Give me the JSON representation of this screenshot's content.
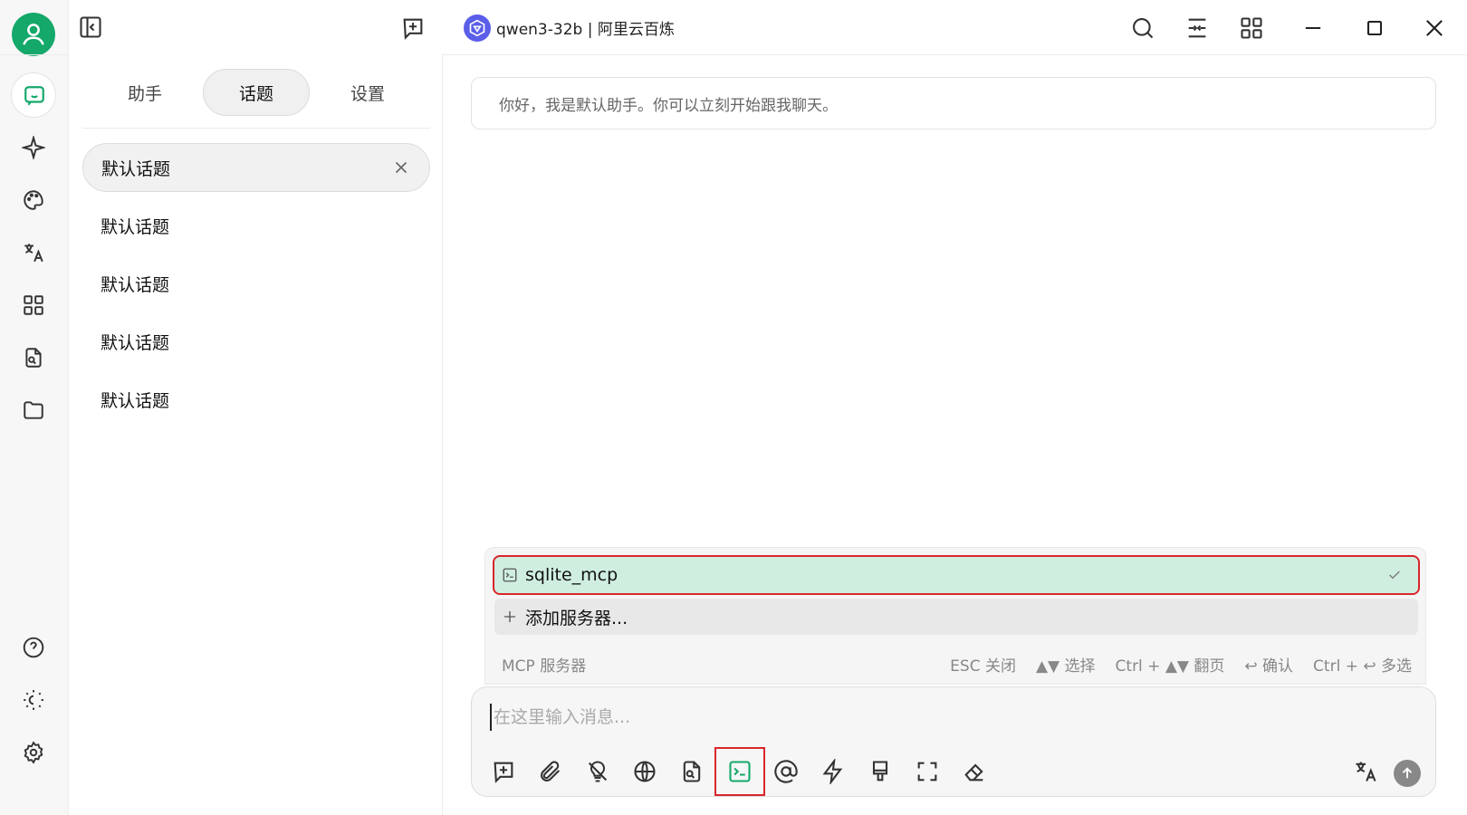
{
  "window": {
    "model_title": "qwen3-32b | 阿里云百炼"
  },
  "topics_panel": {
    "tabs": [
      {
        "label": "助手"
      },
      {
        "label": "话题"
      },
      {
        "label": "设置"
      }
    ],
    "items": [
      {
        "label": "默认话题"
      },
      {
        "label": "默认话题"
      },
      {
        "label": "默认话题"
      },
      {
        "label": "默认话题"
      },
      {
        "label": "默认话题"
      }
    ]
  },
  "chat": {
    "greeting": "你好，我是默认助手。你可以立刻开始跟我聊天。"
  },
  "mcp_popup": {
    "servers": [
      {
        "label": "sqlite_mcp"
      }
    ],
    "add_label": "添加服务器...",
    "footer_label": "MCP 服务器",
    "hints": [
      "ESC 关闭",
      "▲▼ 选择",
      "Ctrl + ▲▼ 翻页",
      "↩ 确认",
      "Ctrl + ↩ 多选"
    ]
  },
  "input": {
    "placeholder": "在这里输入消息..."
  },
  "colors": {
    "accent_green": "#14a86a",
    "highlight_red": "#d9262b",
    "selected_bg": "#cfeee0"
  }
}
